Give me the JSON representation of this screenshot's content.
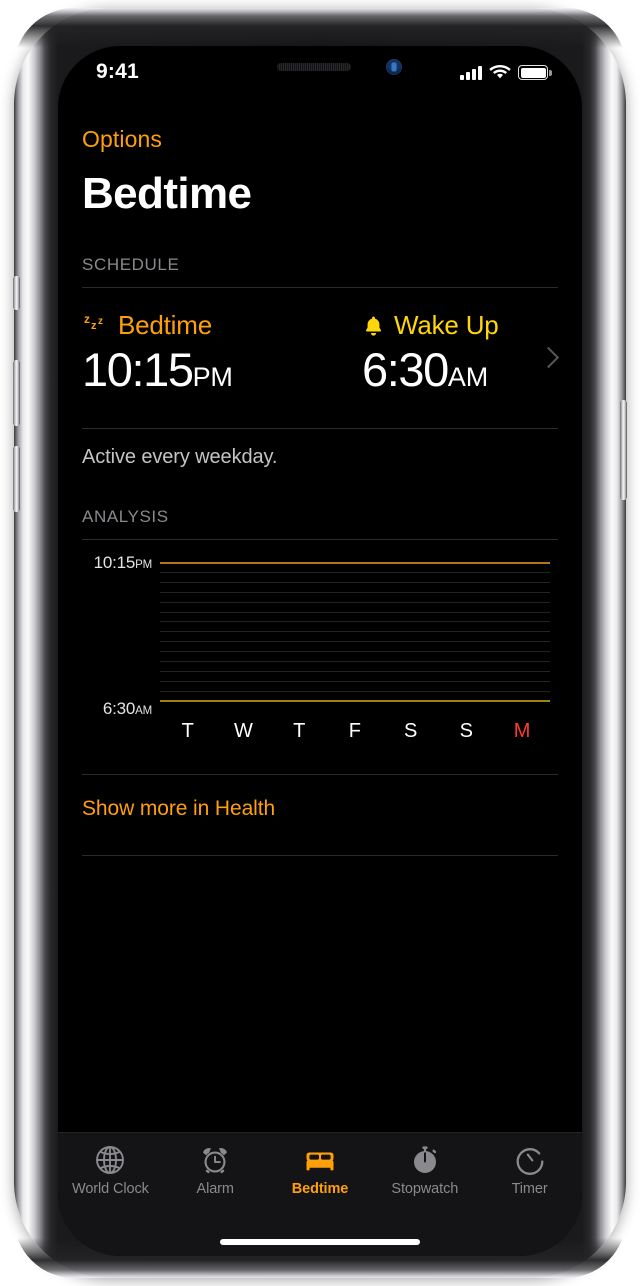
{
  "status_bar": {
    "time": "9:41",
    "signal_icon": "cellular-signal-icon",
    "wifi_icon": "wifi-icon",
    "battery_icon": "battery-icon"
  },
  "nav": {
    "back_label": "Options"
  },
  "header": {
    "title": "Bedtime"
  },
  "schedule": {
    "section_header": "SCHEDULE",
    "bedtime": {
      "icon": "zzz-icon",
      "label": "Bedtime",
      "time": "10:15",
      "meridiem": "PM",
      "color": "#ff9f0a"
    },
    "wakeup": {
      "icon": "bell-icon",
      "label": "Wake Up",
      "time": "6:30",
      "meridiem": "AM",
      "color": "#ffd60a"
    },
    "chevron_icon": "chevron-right-icon",
    "note": "Active every weekday."
  },
  "analysis": {
    "section_header": "ANALYSIS",
    "health_link": "Show more in Health"
  },
  "chart_data": {
    "type": "line",
    "title": "ANALYSIS",
    "xlabel": "",
    "ylabel": "",
    "categories": [
      "T",
      "W",
      "T",
      "F",
      "S",
      "S",
      "M"
    ],
    "today_index": 6,
    "today_color": "#ff3b30",
    "y_axis_top_label": "10:15",
    "y_axis_top_meridiem": "PM",
    "y_axis_bottom_label": "6:30",
    "y_axis_bottom_meridiem": "AM",
    "ylim": [
      "10:15 PM",
      "6:30 AM"
    ],
    "grid": true,
    "gridline_count": 15,
    "gridline_color": "#222224",
    "series": [
      {
        "name": "Bedtime boundary",
        "type": "horizontal-line",
        "position": "top",
        "color": "#b5731b",
        "value": "10:15 PM"
      },
      {
        "name": "Wake Up boundary",
        "type": "horizontal-line",
        "position": "bottom",
        "color": "#9a8310",
        "value": "6:30 AM"
      }
    ],
    "sleep_bars": []
  },
  "tab_bar": {
    "items": [
      {
        "label": "World Clock",
        "icon": "globe-icon",
        "active": false
      },
      {
        "label": "Alarm",
        "icon": "alarm-clock-icon",
        "active": false
      },
      {
        "label": "Bedtime",
        "icon": "bed-icon",
        "active": true
      },
      {
        "label": "Stopwatch",
        "icon": "stopwatch-icon",
        "active": false
      },
      {
        "label": "Timer",
        "icon": "timer-icon",
        "active": false
      }
    ],
    "active_color": "#ff9f0a",
    "inactive_color": "#8a8a8e"
  },
  "home_indicator": "home-indicator"
}
